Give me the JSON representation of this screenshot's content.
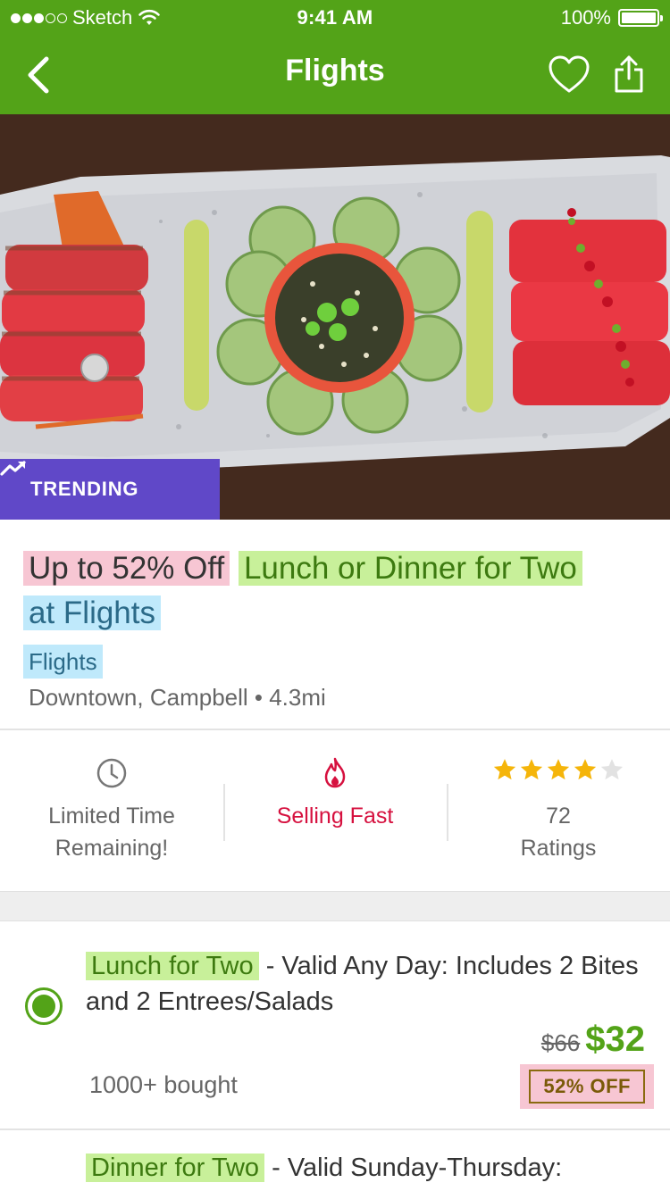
{
  "status_bar": {
    "carrier": "Sketch",
    "time": "9:41 AM",
    "battery": "100%"
  },
  "nav": {
    "title": "Flights",
    "back_icon": "chevron-left-icon",
    "favorite_icon": "heart-icon",
    "share_icon": "share-icon"
  },
  "hero": {
    "badge_icon": "trending-up-icon",
    "badge_label": "TRENDING"
  },
  "deal": {
    "title_part_discount": "Up to 52% Off",
    "title_part_offer": "Lunch or Dinner for Two",
    "title_part_merchant": "at Flights",
    "merchant": "Flights",
    "location": "Downtown, Campbell • 4.3mi"
  },
  "stats": {
    "time_icon": "clock-icon",
    "time_line1": "Limited Time",
    "time_line2": "Remaining!",
    "selling_icon": "flame-icon",
    "selling_label": "Selling Fast",
    "rating_stars": 4,
    "rating_max": 5,
    "ratings_count": "72",
    "ratings_label": "Ratings"
  },
  "options": [
    {
      "name": "Lunch for Two",
      "detail": " - Valid Any Day: Includes 2 Bites and 2 Entrees/Salads",
      "original_price": "$66",
      "price": "$32",
      "bought": "1000+ bought",
      "discount": "52% OFF",
      "selected": true
    },
    {
      "name": "Dinner for Two",
      "detail": " - Valid Sunday-Thursday:"
    }
  ],
  "colors": {
    "brand_green": "#53a318",
    "trending_purple": "#6048c8",
    "selling_red": "#d6113f",
    "star_gold": "#f5b50a"
  }
}
